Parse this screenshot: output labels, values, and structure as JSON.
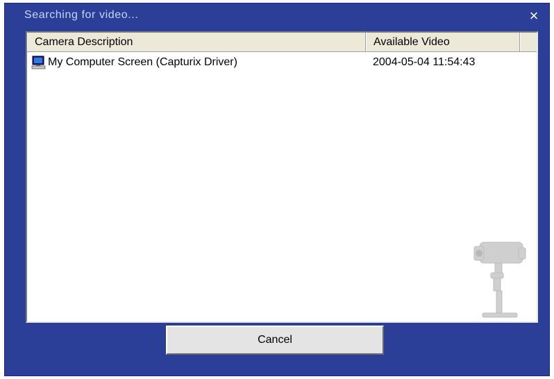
{
  "window": {
    "title": "Searching for video...",
    "close_label": "×",
    "background_color": "#2c3f98"
  },
  "list": {
    "columns": [
      "Camera Description",
      "Available Video"
    ],
    "rows": [
      {
        "icon": "monitor-icon",
        "description": "My Computer Screen (Capturix Driver)",
        "available_video": "2004-05-04  11:54:43"
      }
    ],
    "watermark_icon": "security-camera-icon"
  },
  "buttons": {
    "cancel_label": "Cancel"
  }
}
